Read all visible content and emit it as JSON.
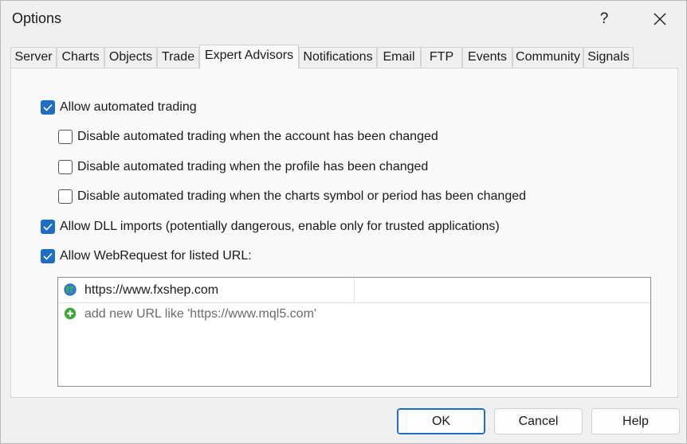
{
  "window": {
    "title": "Options",
    "help_label": "?",
    "close_icon": "close-icon"
  },
  "tabs": [
    {
      "label": "Server"
    },
    {
      "label": "Charts"
    },
    {
      "label": "Objects"
    },
    {
      "label": "Trade"
    },
    {
      "label": "Expert Advisors",
      "active": true
    },
    {
      "label": "Notifications"
    },
    {
      "label": "Email"
    },
    {
      "label": "FTP"
    },
    {
      "label": "Events"
    },
    {
      "label": "Community"
    },
    {
      "label": "Signals"
    }
  ],
  "options": {
    "allow_automated_trading": {
      "label": "Allow automated trading",
      "checked": true
    },
    "disable_on_account_change": {
      "label": "Disable automated trading when the account has been changed",
      "checked": false
    },
    "disable_on_profile_change": {
      "label": "Disable automated trading when the profile has been changed",
      "checked": false
    },
    "disable_on_symbol_change": {
      "label": "Disable automated trading when the charts symbol or period has been changed",
      "checked": false
    },
    "allow_dll_imports": {
      "label": "Allow DLL imports (potentially dangerous, enable only for trusted applications)",
      "checked": true
    },
    "allow_webrequest": {
      "label": "Allow WebRequest for listed URL:",
      "checked": true
    }
  },
  "url_list": {
    "items": [
      {
        "url": "https://www.fxshep.com",
        "icon": "globe-icon"
      }
    ],
    "add_placeholder": "add new URL like 'https://www.mql5.com'",
    "add_icon": "add-plus-icon"
  },
  "buttons": {
    "ok": "OK",
    "cancel": "Cancel",
    "help": "Help"
  },
  "colors": {
    "accent": "#1e6fc4",
    "add_icon": "#3aa935"
  }
}
